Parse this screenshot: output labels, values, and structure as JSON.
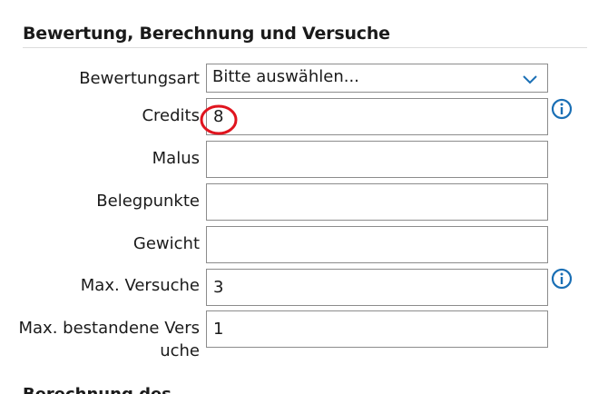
{
  "section": {
    "title": "Bewertung, Berechnung und Versuche",
    "next_title": "Berechnung des..."
  },
  "fields": {
    "bewertungsart": {
      "label": "Bewertungsart",
      "value": "Bitte auswählen..."
    },
    "credits": {
      "label": "Credits",
      "value": "8"
    },
    "malus": {
      "label": "Malus",
      "value": ""
    },
    "belegpunkte": {
      "label": "Belegpunkte",
      "value": ""
    },
    "gewicht": {
      "label": "Gewicht",
      "value": ""
    },
    "max_versuche": {
      "label": "Max. Versuche",
      "value": "3"
    },
    "max_bestandene": {
      "label": "Max. bestandene Versuche",
      "value": "1"
    }
  },
  "icons": {
    "info": "info-icon",
    "dropdown": "chevron-down-icon"
  },
  "colors": {
    "accent": "#1a6fb5",
    "annotation": "#e0141e",
    "border": "#8c8c8c"
  }
}
